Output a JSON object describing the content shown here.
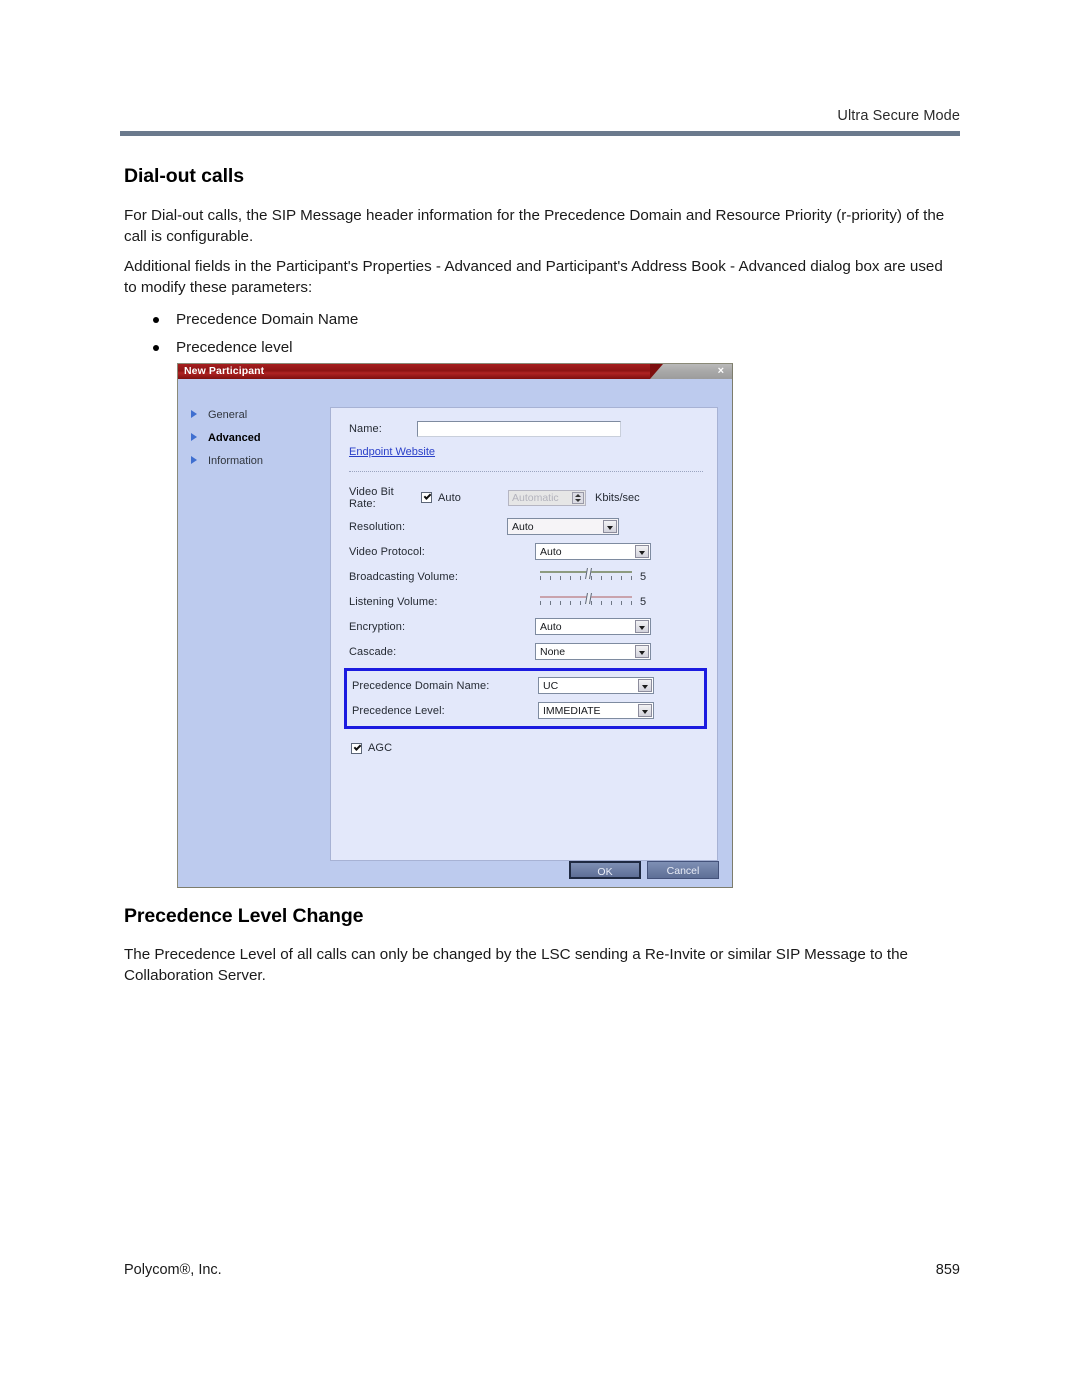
{
  "header": {
    "running_head": "Ultra Secure Mode"
  },
  "sections": [
    {
      "title": "Dial-out calls",
      "paragraphs": [
        "For Dial-out calls, the SIP Message header information for the Precedence Domain and Resource Priority (r-priority) of the call is configurable.",
        "Additional fields in the Participant's Properties - Advanced and Participant's Address Book - Advanced dialog box are used to modify these parameters:"
      ],
      "bullets": [
        "Precedence Domain Name",
        "Precedence level"
      ]
    },
    {
      "title": "Precedence Level Change",
      "paragraphs": [
        "The Precedence Level of all calls can only be changed by the LSC sending a Re-Invite or similar SIP Message to the Collaboration Server."
      ]
    }
  ],
  "dialog": {
    "title": "New Participant",
    "close_label": "×",
    "nav": [
      {
        "label": "General",
        "active": false
      },
      {
        "label": "Advanced",
        "active": true
      },
      {
        "label": "Information",
        "active": false
      }
    ],
    "fields": {
      "name_label": "Name:",
      "name_value": "",
      "endpoint_link": "Endpoint Website",
      "video_bit_rate_label": "Video Bit Rate:",
      "auto_checkbox_label": "Auto",
      "bitrate_value": "Automatic",
      "bitrate_unit": "Kbits/sec",
      "resolution_label": "Resolution:",
      "resolution_value": "Auto",
      "video_protocol_label": "Video Protocol:",
      "video_protocol_value": "Auto",
      "broadcasting_volume_label": "Broadcasting Volume:",
      "broadcasting_volume_value": "5",
      "listening_volume_label": "Listening Volume:",
      "listening_volume_value": "5",
      "encryption_label": "Encryption:",
      "encryption_value": "Auto",
      "cascade_label": "Cascade:",
      "cascade_value": "None",
      "precedence_domain_label": "Precedence Domain Name:",
      "precedence_domain_value": "UC",
      "precedence_level_label": "Precedence Level:",
      "precedence_level_value": "IMMEDIATE",
      "agc_label": "AGC"
    },
    "buttons": {
      "ok": "OK",
      "cancel": "Cancel"
    },
    "highlight_color": "#1b1be0"
  },
  "footer": {
    "company": "Polycom®, Inc.",
    "page_number": "859"
  }
}
